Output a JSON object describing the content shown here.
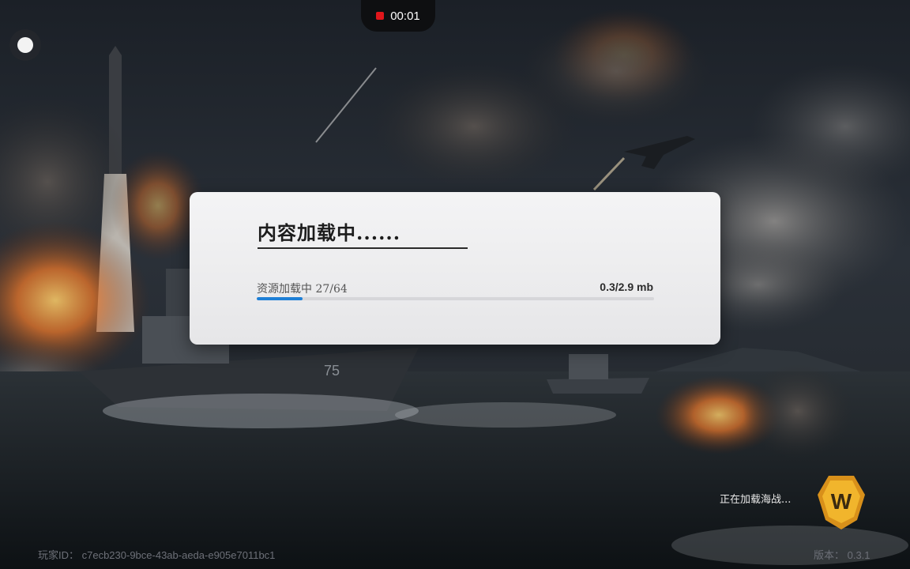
{
  "recording": {
    "timer": "00:01",
    "status_color": "#e0161b"
  },
  "dialog": {
    "title": "内容加载中......",
    "progress_label": "资源加载中 27/64",
    "progress_size": "0.3/2.9 mb",
    "progress_fraction": 0.1147,
    "accent": "#1d7fd6"
  },
  "footer": {
    "loading_text": "正在加载海战...",
    "player_id": "玩家ID：  c7ecb230-9bce-43ab-aeda-e905e7011bc1",
    "version": "版本：  0.3.1",
    "logo_letter": "W",
    "logo_color": "#e3a21a"
  },
  "icons": [
    "record-stop-icon",
    "floating-assist-icon",
    "game-logo-icon"
  ]
}
